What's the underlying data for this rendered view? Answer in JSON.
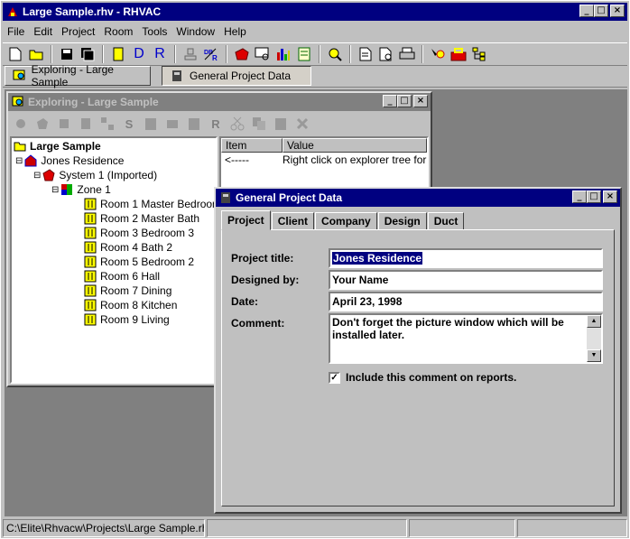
{
  "app": {
    "title": "Large Sample.rhv - RHVAC",
    "menu": [
      "File",
      "Edit",
      "Project",
      "Room",
      "Tools",
      "Window",
      "Help"
    ],
    "toolbar_letters": {
      "d": "D",
      "r": "R"
    }
  },
  "window_tabs": [
    {
      "label": "Exploring - Large Sample"
    },
    {
      "label": "General Project Data"
    }
  ],
  "explorer": {
    "title": "Exploring - Large Sample",
    "toolbar_letters": {
      "s": "S",
      "r": "R"
    },
    "tree": {
      "root": "Large Sample",
      "residence": "Jones Residence",
      "system": "System 1 (Imported)",
      "zone": "Zone 1",
      "rooms": [
        "Room 1 Master Bedroom",
        "Room 2 Master Bath",
        "Room 3 Bedroom 3",
        "Room 4 Bath 2",
        "Room 5 Bedroom 2",
        "Room 6 Hall",
        "Room 7 Dining",
        "Room 8 Kitchen",
        "Room 9 Living"
      ]
    },
    "list": {
      "columns": [
        "Item",
        "Value"
      ],
      "row": {
        "item": "<-----",
        "value": "Right click on explorer tree for ..."
      }
    }
  },
  "dialog": {
    "title": "General Project Data",
    "tabs": [
      "Project",
      "Client",
      "Company",
      "Design",
      "Duct"
    ],
    "labels": {
      "project_title": "Project title:",
      "designed_by": "Designed by:",
      "date": "Date:",
      "comment": "Comment:"
    },
    "values": {
      "project_title": "Jones Residence",
      "designed_by": "Your Name",
      "date": "April 23, 1998",
      "comment": "Don't forget the picture window which will be installed later."
    },
    "include_comment": {
      "checked": true,
      "label": "Include this comment on reports."
    }
  },
  "status": {
    "path": "C:\\Elite\\Rhvacw\\Projects\\Large Sample.rhv"
  }
}
